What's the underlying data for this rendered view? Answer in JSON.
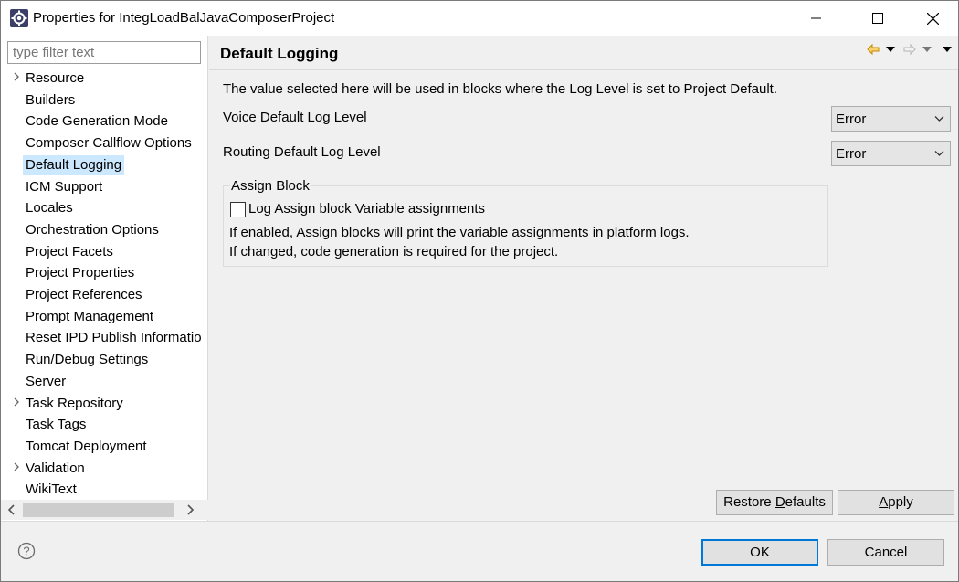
{
  "window": {
    "title": "Properties for IntegLoadBalJavaComposerProject",
    "app_icon": "eclipse-gear-icon"
  },
  "sidebar": {
    "filter_placeholder": "type filter text",
    "items": [
      {
        "label": "Resource",
        "expandable": true
      },
      {
        "label": "Builders",
        "expandable": false
      },
      {
        "label": "Code Generation Mode",
        "expandable": false
      },
      {
        "label": "Composer Callflow Options",
        "expandable": false
      },
      {
        "label": "Default Logging",
        "expandable": false,
        "selected": true
      },
      {
        "label": "ICM Support",
        "expandable": false
      },
      {
        "label": "Locales",
        "expandable": false
      },
      {
        "label": "Orchestration Options",
        "expandable": false
      },
      {
        "label": "Project Facets",
        "expandable": false
      },
      {
        "label": "Project Properties",
        "expandable": false
      },
      {
        "label": "Project References",
        "expandable": false
      },
      {
        "label": "Prompt Management",
        "expandable": false
      },
      {
        "label": "Reset IPD Publish Informatio",
        "expandable": false
      },
      {
        "label": "Run/Debug Settings",
        "expandable": false
      },
      {
        "label": "Server",
        "expandable": false
      },
      {
        "label": "Task Repository",
        "expandable": true
      },
      {
        "label": "Task Tags",
        "expandable": false
      },
      {
        "label": "Tomcat Deployment",
        "expandable": false
      },
      {
        "label": "Validation",
        "expandable": true
      },
      {
        "label": "WikiText",
        "expandable": false
      }
    ]
  },
  "page": {
    "title": "Default Logging",
    "description": "The value selected here will be used in blocks where the Log Level is set to Project Default.",
    "voice_label": "Voice Default Log Level",
    "voice_value": "Error",
    "routing_label": "Routing Default Log Level",
    "routing_value": "Error",
    "group": {
      "title": "Assign Block",
      "checkbox_label": "Log Assign block Variable assignments",
      "checkbox_checked": false,
      "help_line1": "If enabled, Assign blocks will print the variable assignments in platform logs.",
      "help_line2": "If changed, code generation is required for the project."
    },
    "restore_defaults_label": "Restore Defaults",
    "restore_defaults_mnemonic": "D",
    "apply_label": "Apply",
    "apply_mnemonic": "A"
  },
  "footer": {
    "ok_label": "OK",
    "cancel_label": "Cancel"
  },
  "colors": {
    "selection": "#cce8ff",
    "nav_back": "#e8a317",
    "ok_border": "#0078d7"
  }
}
